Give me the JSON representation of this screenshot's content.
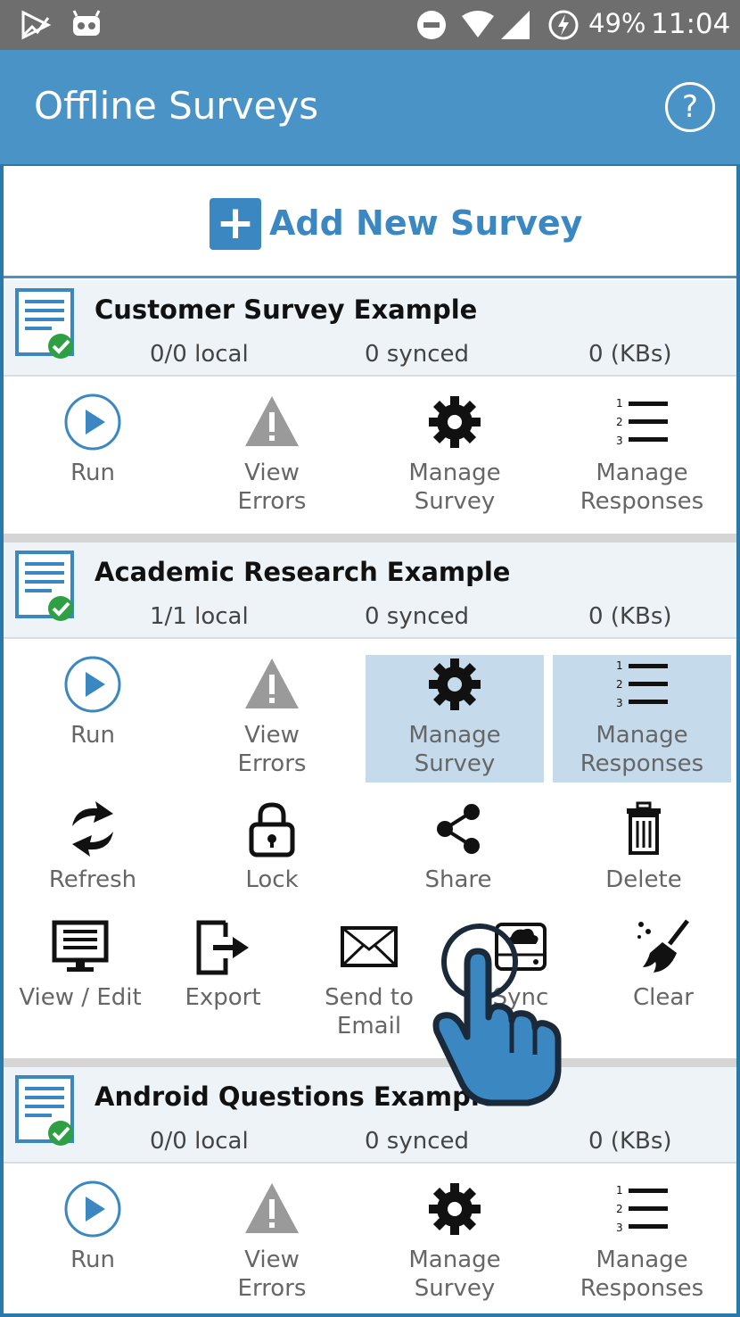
{
  "status_bar": {
    "battery": "49%",
    "time": "11:04"
  },
  "app_bar": {
    "title": "Offline Surveys",
    "help_label": "?"
  },
  "add_survey": {
    "label": "Add New Survey"
  },
  "surveys": [
    {
      "title": "Customer Survey Example",
      "local": "0/0 local",
      "synced": "0 synced",
      "size": "0 (KBs)"
    },
    {
      "title": "Academic Research Example",
      "local": "1/1 local",
      "synced": "0 synced",
      "size": "0 (KBs)"
    },
    {
      "title": "Android Questions Example",
      "local": "0/0 local",
      "synced": "0 synced",
      "size": "0 (KBs)"
    }
  ],
  "actions": {
    "run": "Run",
    "view_errors_1": "View",
    "view_errors_2": "Errors",
    "manage_survey_1": "Manage",
    "manage_survey_2": "Survey",
    "manage_responses_1": "Manage",
    "manage_responses_2": "Responses",
    "refresh": "Refresh",
    "lock": "Lock",
    "share": "Share",
    "delete": "Delete",
    "view_edit": "View / Edit",
    "export": "Export",
    "send_to_email_1": "Send to",
    "send_to_email_2": "Email",
    "sync": "Sync",
    "clear": "Clear"
  },
  "colors": {
    "primary": "#4a93c7",
    "accent": "#3b87c2",
    "highlight": "#c5dbeb",
    "status_bar": "#6e6e6e"
  },
  "icons": [
    "play-icon",
    "warning-icon",
    "gear-icon",
    "list-icon",
    "refresh-icon",
    "lock-icon",
    "share-icon",
    "trash-icon",
    "monitor-icon",
    "export-icon",
    "envelope-icon",
    "sync-icon",
    "broom-icon",
    "hand-pointer-icon"
  ]
}
